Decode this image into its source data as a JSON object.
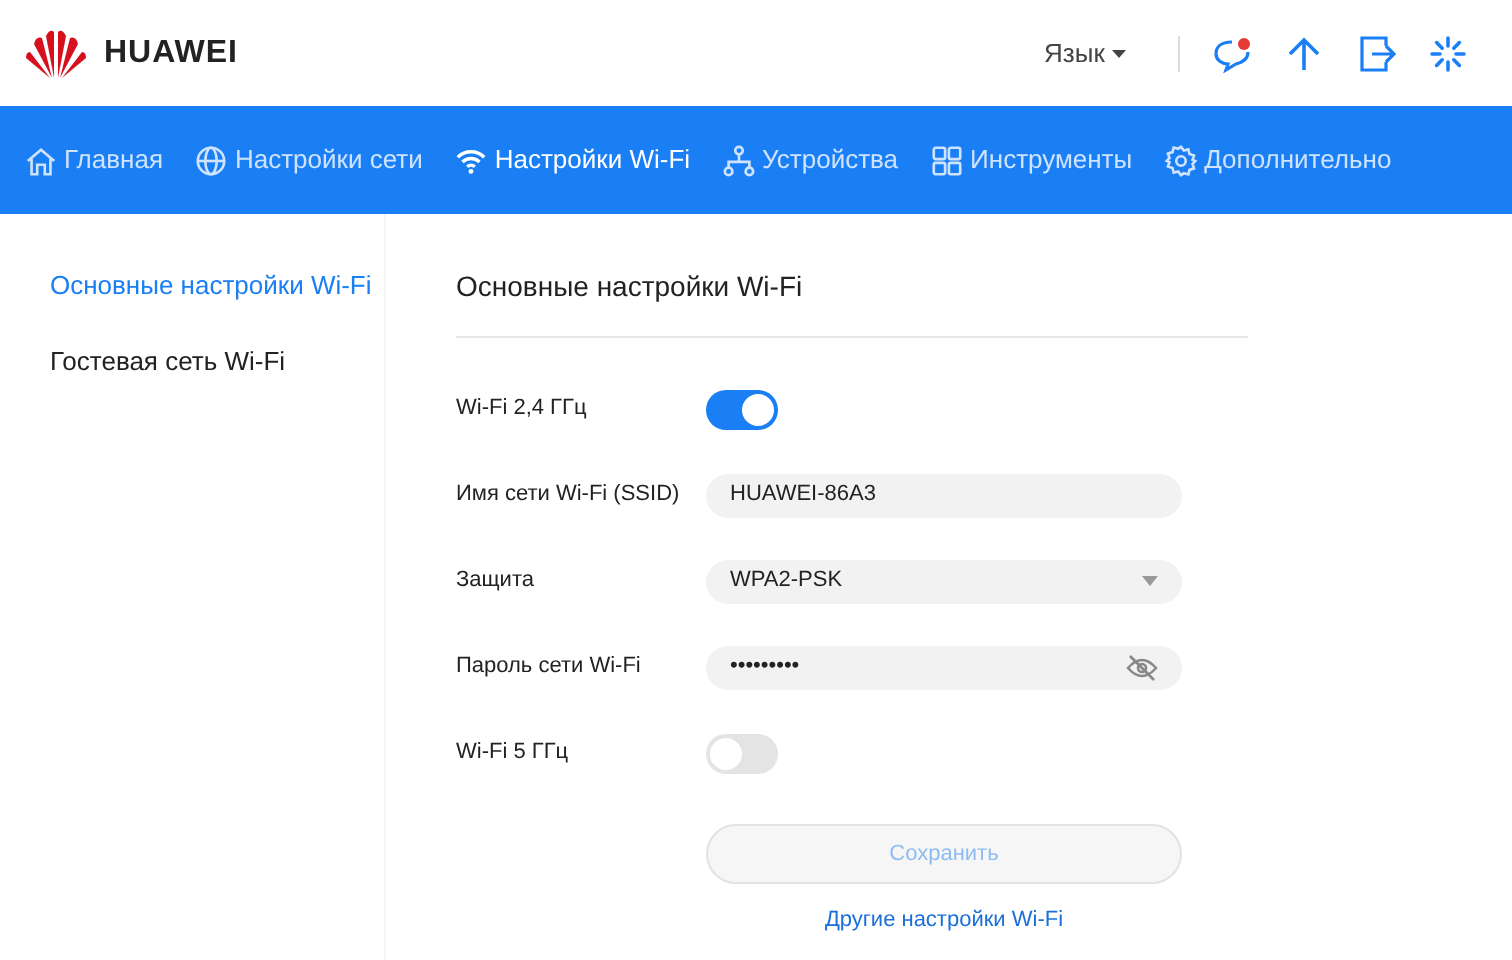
{
  "header": {
    "brand": "HUAWEI",
    "language": "Язык"
  },
  "nav": [
    {
      "label": "Главная",
      "kind": "home",
      "selected": false
    },
    {
      "label": "Настройки сети",
      "kind": "globe",
      "selected": false
    },
    {
      "label": "Настройки Wi-Fi",
      "kind": "wifi",
      "selected": true
    },
    {
      "label": "Устройства",
      "kind": "tree",
      "selected": false
    },
    {
      "label": "Инструменты",
      "kind": "grid",
      "selected": false
    },
    {
      "label": "Дополнительно",
      "kind": "gear",
      "selected": false
    }
  ],
  "sidebar": {
    "items": [
      {
        "label": "Основные настройки Wi-Fi",
        "selected": true
      },
      {
        "label": "Гостевая сеть Wi-Fi",
        "selected": false
      }
    ]
  },
  "form": {
    "title": "Основные настройки Wi-Fi",
    "fields": [
      {
        "kind": "toggle",
        "label": "Wi-Fi 2,4 ГГц",
        "on": true
      },
      {
        "kind": "text",
        "label": "Имя сети Wi-Fi (SSID)",
        "value": "HUAWEI-86A3"
      },
      {
        "kind": "select",
        "label": "Защита",
        "value": "WPA2-PSK"
      },
      {
        "kind": "password",
        "label": "Пароль сети Wi-Fi",
        "value": "•••••••••"
      },
      {
        "kind": "toggle",
        "label": "Wi-Fi 5 ГГц",
        "on": false
      }
    ],
    "save": {
      "label": "Сохранить",
      "disabled": true
    },
    "link": "Другие настройки Wi-Fi"
  }
}
